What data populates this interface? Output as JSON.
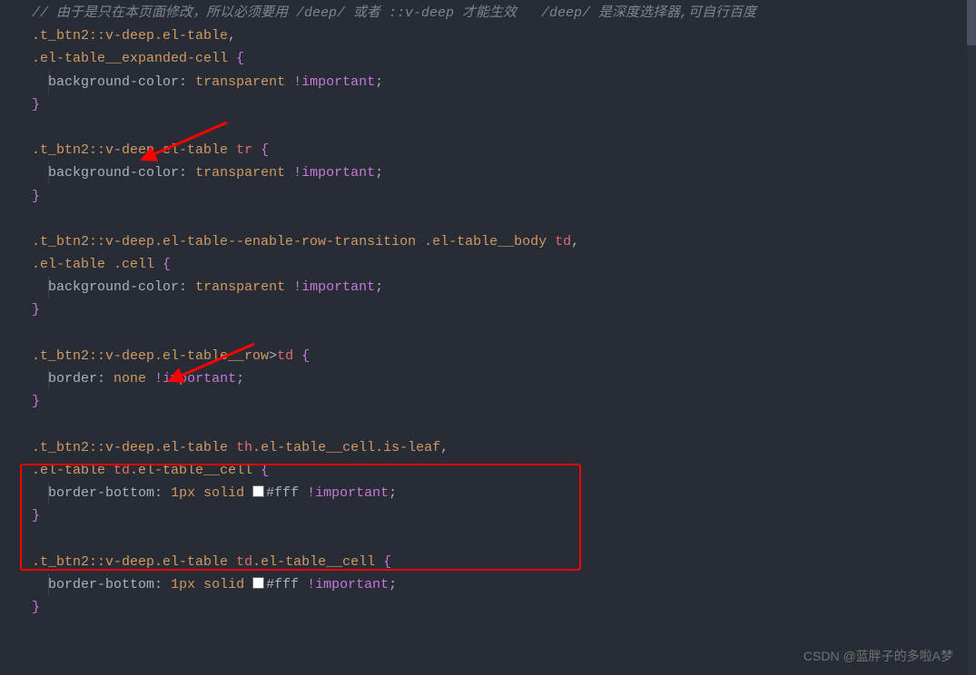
{
  "watermark": "CSDN @蓝胖子的多啦A梦",
  "code": {
    "comment_line": "// 由于是只在本页面修改，所以必须要用 /deep/ 或者 ::v-deep 才能生效   /deep/ 是深度选择器,可自行百度",
    "block1": {
      "selector_line1": ".t_btn2::v-deep.el-table,",
      "selector_line2": ".el-table__expanded-cell {",
      "prop_line": "  background-color: transparent !important;",
      "close": "}"
    },
    "block2": {
      "selector": ".t_btn2::v-deep.el-table tr {",
      "prop_line": "  background-color: transparent !important;",
      "close": "}"
    },
    "block3": {
      "selector_line1": ".t_btn2::v-deep.el-table--enable-row-transition .el-table__body td,",
      "selector_line2": ".el-table .cell {",
      "prop_line": "  background-color: transparent !important;",
      "close": "}"
    },
    "block4": {
      "selector": ".t_btn2::v-deep.el-table__row>td {",
      "prop_line": "  border: none !important;",
      "close": "}"
    },
    "block5": {
      "selector_line1": ".t_btn2::v-deep.el-table th.el-table__cell.is-leaf,",
      "selector_line2": ".el-table td.el-table__cell {",
      "prop_line_prefix": "  border-bottom: 1px solid ",
      "hex_color": "#fff",
      "prop_line_suffix": " !important;",
      "close": "}"
    },
    "block6": {
      "selector": ".t_btn2::v-deep.el-table td.el-table__cell {",
      "prop_line_prefix": "  border-bottom: 1px solid ",
      "hex_color": "#fff",
      "prop_line_suffix": " !important;",
      "close": "}"
    }
  },
  "tokens": {
    "t_btn2": ".t_btn2",
    "vdeep": "::v-deep",
    "el_table": ".el-table",
    "comma": ",",
    "el_table_expanded": ".el-table__expanded-cell",
    "brace_open": " {",
    "brace_close": "}",
    "bg_color": "background-color",
    "colon_sp": ": ",
    "transparent": "transparent",
    "sp": " ",
    "important": "!important",
    "semi": ";",
    "tr": "tr",
    "el_table_enable": ".el-table--enable-row-transition",
    "el_table_body": ".el-table__body",
    "td": "td",
    "cell": ".cell",
    "el_table_row": ".el-table__row",
    "gt": ">",
    "border": "border",
    "none": "none",
    "th": "th",
    "el_table_cell": ".el-table__cell",
    "is_leaf": ".is-leaf",
    "border_bottom": "border-bottom",
    "px1": "1px",
    "solid": "solid",
    "indent": "  "
  }
}
